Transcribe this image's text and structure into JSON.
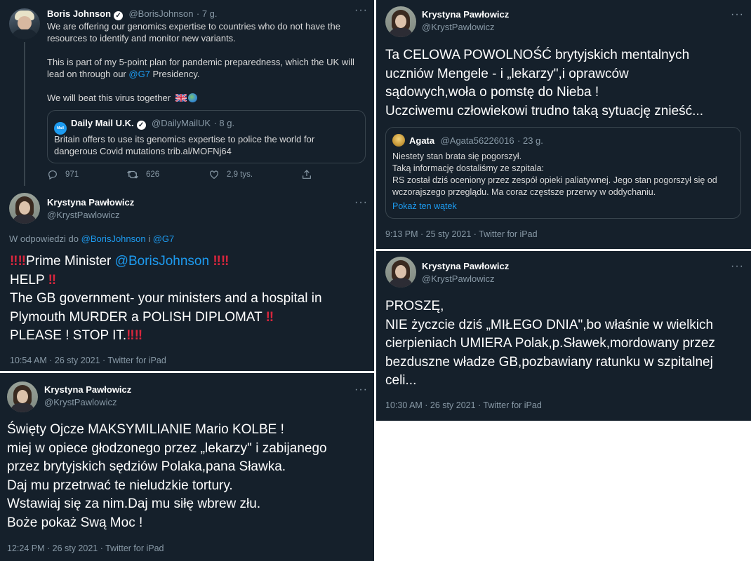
{
  "panel1": {
    "bj": {
      "name": "Boris Johnson",
      "handle": "@BorisJohnson",
      "time": "· 7 g.",
      "line1": "We are offering our genomics expertise to countries who do not have the",
      "line2": "resources to identify and monitor new variants.",
      "line3": "This is part of my 5-point plan for pandemic preparedness, which the UK will",
      "line4_pre": "lead on through our ",
      "line4_link": "@G7",
      "line4_post": " Presidency.",
      "line5": "We will beat this virus together"
    },
    "quote": {
      "avatar_text": "Mail",
      "name": "Daily Mail U.K.",
      "handle": "@DailyMailUK",
      "time": "· 8 g.",
      "line1": "Britain offers to use its genomics expertise to police the world for",
      "line2": "dangerous Covid mutations trib.al/MOFNj64"
    },
    "actions": {
      "replies": "971",
      "retweets": "626",
      "likes": "2,9 tys."
    },
    "kp": {
      "name": "Krystyna Pawłowicz",
      "handle": "@KrystPawlowicz",
      "reply_pre": "W odpowiedzi do ",
      "reply_link1": "@BorisJohnson",
      "reply_mid": " i ",
      "reply_link2": "@G7",
      "l1_text": "Prime Minister ",
      "l1_link": "@BorisJohnson",
      "l2": "HELP",
      "l3": "The GB government- your ministers and a hospital in",
      "l4": "Plymouth MURDER a POLISH DIPLOMAT",
      "l5": "PLEASE ! STOP IT.",
      "bang": "‼",
      "meta": "10:54 AM · 26 sty 2021 · Twitter for iPad"
    }
  },
  "panel2": {
    "name": "Krystyna Pawłowicz",
    "handle": "@KrystPawlowicz",
    "lines": [
      "Święty Ojcze MAKSYMILIANIE Mario KOLBE !",
      "miej w opiece głodzonego przez „lekarzy\" i zabijanego",
      "przez brytyjskich sędziów Polaka,pana Sławka.",
      "Daj mu przetrwać te nieludzkie tortury.",
      "Wstawiaj się za nim.Daj mu siłę wbrew złu.",
      "Boże pokaż Swą Moc !"
    ],
    "meta": "12:24 PM · 26 sty 2021 · Twitter for iPad"
  },
  "panel3": {
    "name": "Krystyna Pawłowicz",
    "handle": "@KrystPawlowicz",
    "lines": [
      "Ta CELOWA POWOLNOŚĆ brytyjskich mentalnych",
      "uczniów Mengele - i „lekarzy\",i oprawców",
      "sądowych,woła o pomstę do Nieba !",
      "Uczciwemu człowiekowi trudno taką sytuację znieść..."
    ],
    "quote": {
      "name": "Agata",
      "handle": "@Agata56226016",
      "time": "· 23 g.",
      "lines": [
        "Niestety stan brata się pogorszył.",
        "Taką informację dostaliśmy ze szpitala:",
        "RS został dziś oceniony przez zespół opieki paliatywnej. Jego stan pogorszył się od",
        "wczorajszego przeglądu. Ma coraz częstsze przerwy w oddychaniu."
      ],
      "thread_link": "Pokaż ten wątek"
    },
    "meta": "9:13 PM · 25 sty 2021 · Twitter for iPad"
  },
  "panel4": {
    "name": "Krystyna Pawłowicz",
    "handle": "@KrystPawlowicz",
    "lines": [
      "PROSZĘ,",
      "NIE życzcie dziś „MIŁEGO DNIA\",bo właśnie w wielkich",
      "cierpieniach UMIERA Polak,p.Sławek,mordowany przez",
      "bezduszne władze GB,pozbawiany ratunku w szpitalnej",
      "celi..."
    ],
    "meta": "10:30 AM · 26 sty 2021 · Twitter for iPad"
  },
  "colors": {
    "background": "#15202b",
    "link": "#1d9bf0",
    "muted": "#8899a6",
    "border": "#38444d",
    "alert": "#d7263d"
  },
  "icons": [
    "verified-icon",
    "more-icon",
    "reply-icon",
    "retweet-icon",
    "like-icon",
    "share-icon",
    "uk-flag-icon",
    "globe-icon",
    "double-exclamation-icon"
  ]
}
